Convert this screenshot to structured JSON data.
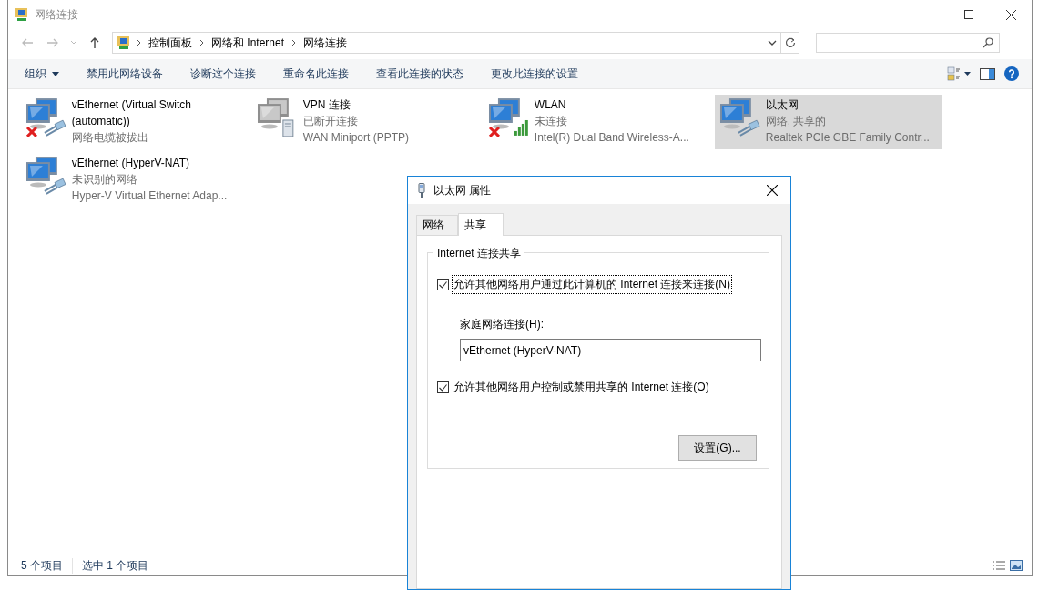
{
  "window": {
    "title": "网络连接"
  },
  "address_bar": {
    "crumbs": [
      "控制面板",
      "网络和 Internet",
      "网络连接"
    ]
  },
  "toolbar": {
    "commands": [
      "组织",
      "禁用此网络设备",
      "诊断这个连接",
      "重命名此连接",
      "查看此连接的状态",
      "更改此连接的设置"
    ]
  },
  "connections": [
    {
      "name": "vEthernet (Virtual Switch (automatic))",
      "status": "网络电缆被拔出",
      "kind": "ethernet",
      "disconnected": true,
      "selected": false
    },
    {
      "name": "VPN 连接",
      "status": "已断开连接",
      "device": "WAN Miniport (PPTP)",
      "kind": "vpn",
      "disconnected": false,
      "selected": false
    },
    {
      "name": "WLAN",
      "status": "未连接",
      "device": "Intel(R) Dual Band Wireless-A...",
      "kind": "wifi",
      "disconnected": true,
      "selected": false
    },
    {
      "name": "以太网",
      "status": "网络, 共享的",
      "device": "Realtek PCIe GBE Family Contr...",
      "kind": "ethernet",
      "disconnected": false,
      "selected": true
    },
    {
      "name": "vEthernet (HyperV-NAT)",
      "status": "未识别的网络",
      "device": "Hyper-V Virtual Ethernet Adap...",
      "kind": "ethernet",
      "disconnected": false,
      "selected": false
    }
  ],
  "status_bar": {
    "item_count": "5 个项目",
    "selection": "选中 1 个项目"
  },
  "dialog": {
    "title": "以太网 属性",
    "tabs": [
      {
        "label": "网络",
        "selected": false
      },
      {
        "label": "共享",
        "selected": true
      }
    ],
    "group_title": "Internet 连接共享",
    "allow_sharing": {
      "label": "允许其他网络用户通过此计算机的 Internet 连接来连接(N)",
      "checked": true,
      "focused": true
    },
    "home_network": {
      "label": "家庭网络连接(H):",
      "value": "vEthernet (HyperV-NAT)"
    },
    "allow_control": {
      "label": "允许其他网络用户控制或禁用共享的 Internet 连接(O)",
      "checked": true,
      "focused": false
    },
    "settings_button": "设置(G)..."
  }
}
